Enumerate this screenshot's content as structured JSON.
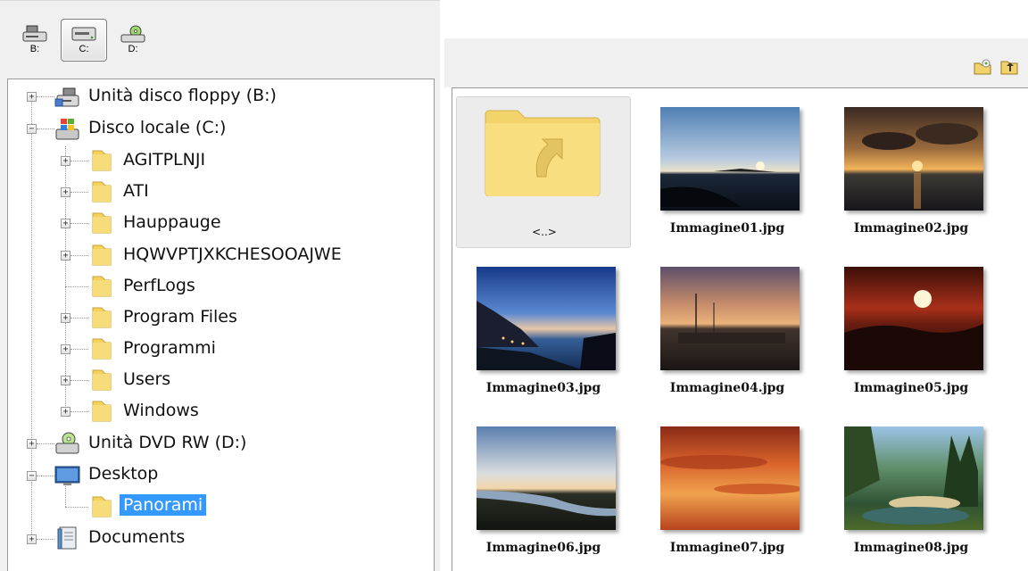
{
  "drives": [
    {
      "letter": "B:",
      "type": "floppy",
      "icon": "floppy-drive-icon",
      "selected": false
    },
    {
      "letter": "C:",
      "type": "hard-disk",
      "icon": "hard-disk-icon",
      "selected": true
    },
    {
      "letter": "D:",
      "type": "dvd",
      "icon": "dvd-drive-icon",
      "selected": false
    }
  ],
  "tree": {
    "floppy": "Unità disco floppy (B:)",
    "local_disk": "Disco locale (C:)",
    "folders": [
      "AGITPLNJI",
      "ATI",
      "Hauppauge",
      "HQWVPTJXKCHESOOAJWE",
      "PerfLogs",
      "Program Files",
      "Programmi",
      "Users",
      "Windows"
    ],
    "dvd": "Unità DVD RW (D:)",
    "desktop": "Desktop",
    "panorami": "Panorami",
    "documents": "Documents",
    "selected_item": "Panorami"
  },
  "toolbar": {
    "new_folder_icon": "new-folder-icon",
    "up_folder_icon": "up-folder-icon"
  },
  "gallery": {
    "up_label": "<..>",
    "images": [
      "Immagine01.jpg",
      "Immagine02.jpg",
      "Immagine03.jpg",
      "Immagine04.jpg",
      "Immagine05.jpg",
      "Immagine06.jpg",
      "Immagine07.jpg",
      "Immagine08.jpg"
    ]
  },
  "colors": {
    "selection": "#3399ff",
    "folder": "#f5d25c",
    "panel_bg": "#f0f0f0"
  }
}
